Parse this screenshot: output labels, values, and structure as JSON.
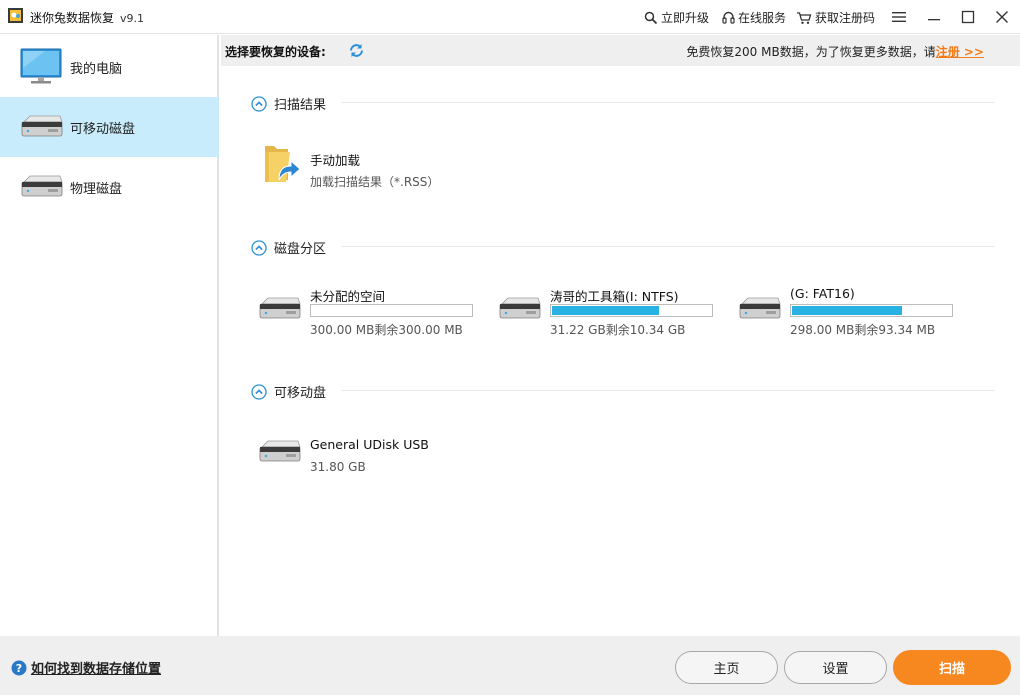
{
  "app": {
    "title": "迷你兔数据恢复",
    "version": "v9.1"
  },
  "toplinks": {
    "upgrade": "立即升级",
    "service": "在线服务",
    "register": "获取注册码"
  },
  "sidebar": {
    "items": [
      {
        "label": "我的电脑",
        "icon": "monitor-icon"
      },
      {
        "label": "可移动磁盘",
        "icon": "drive-icon",
        "active": true
      },
      {
        "label": "物理磁盘",
        "icon": "drive-icon"
      }
    ]
  },
  "device_bar": {
    "label": "选择要恢复的设备:",
    "promo_text": "免费恢复200 MB数据，为了恢复更多数据，请",
    "promo_link": "注册 >>"
  },
  "sections": {
    "scan_results": {
      "title": "扫描结果",
      "manual": {
        "name": "手动加载",
        "desc": "加载扫描结果（*.RSS）"
      }
    },
    "partitions": {
      "title": "磁盘分区",
      "items": [
        {
          "name": "未分配的空间",
          "usage": "300.00 MB剩余300.00 MB",
          "fill_fraction": 0.0
        },
        {
          "name": "涛哥的工具箱(I: NTFS)",
          "usage": "31.22 GB剩余10.34 GB",
          "fill_fraction": 0.67
        },
        {
          "name": "(G: FAT16)",
          "usage": "298.00 MB剩余93.34 MB",
          "fill_fraction": 0.69
        }
      ]
    },
    "removable": {
      "title": "可移动盘",
      "items": [
        {
          "name": "General UDisk USB",
          "size": "31.80 GB"
        }
      ]
    }
  },
  "footer": {
    "help": "如何找到数据存储位置",
    "home": "主页",
    "settings": "设置",
    "scan": "扫描"
  },
  "colors": {
    "accent": "#f7871f",
    "selection": "#c8ecfb",
    "bar_fill": "#28b1e3",
    "link": "#f57b17"
  }
}
